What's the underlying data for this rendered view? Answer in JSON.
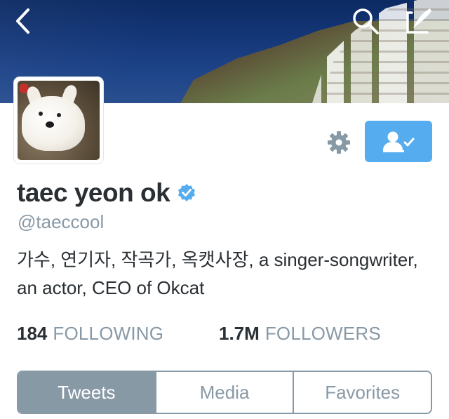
{
  "header": {
    "back_icon": "chevron-left-icon",
    "search_icon": "search-icon",
    "compose_icon": "compose-tweet-icon"
  },
  "profile": {
    "name": "taec yeon ok",
    "verified": true,
    "handle": "@taeccool",
    "bio": "가수, 연기자, 작곡가, 옥캣사장, a singer-songwriter, an actor, CEO of Okcat"
  },
  "actions": {
    "settings_icon": "gear-icon",
    "follow_icon": "following-user-check-icon",
    "follow_color": "#55acee"
  },
  "stats": {
    "following_count": "184",
    "following_label": "FOLLOWING",
    "followers_count": "1.7M",
    "followers_label": "FOLLOWERS"
  },
  "tabs": [
    {
      "label": "Tweets",
      "active": true
    },
    {
      "label": "Media",
      "active": false
    },
    {
      "label": "Favorites",
      "active": false
    }
  ],
  "colors": {
    "accent": "#55acee",
    "muted": "#8899a6",
    "text": "#292f33"
  }
}
